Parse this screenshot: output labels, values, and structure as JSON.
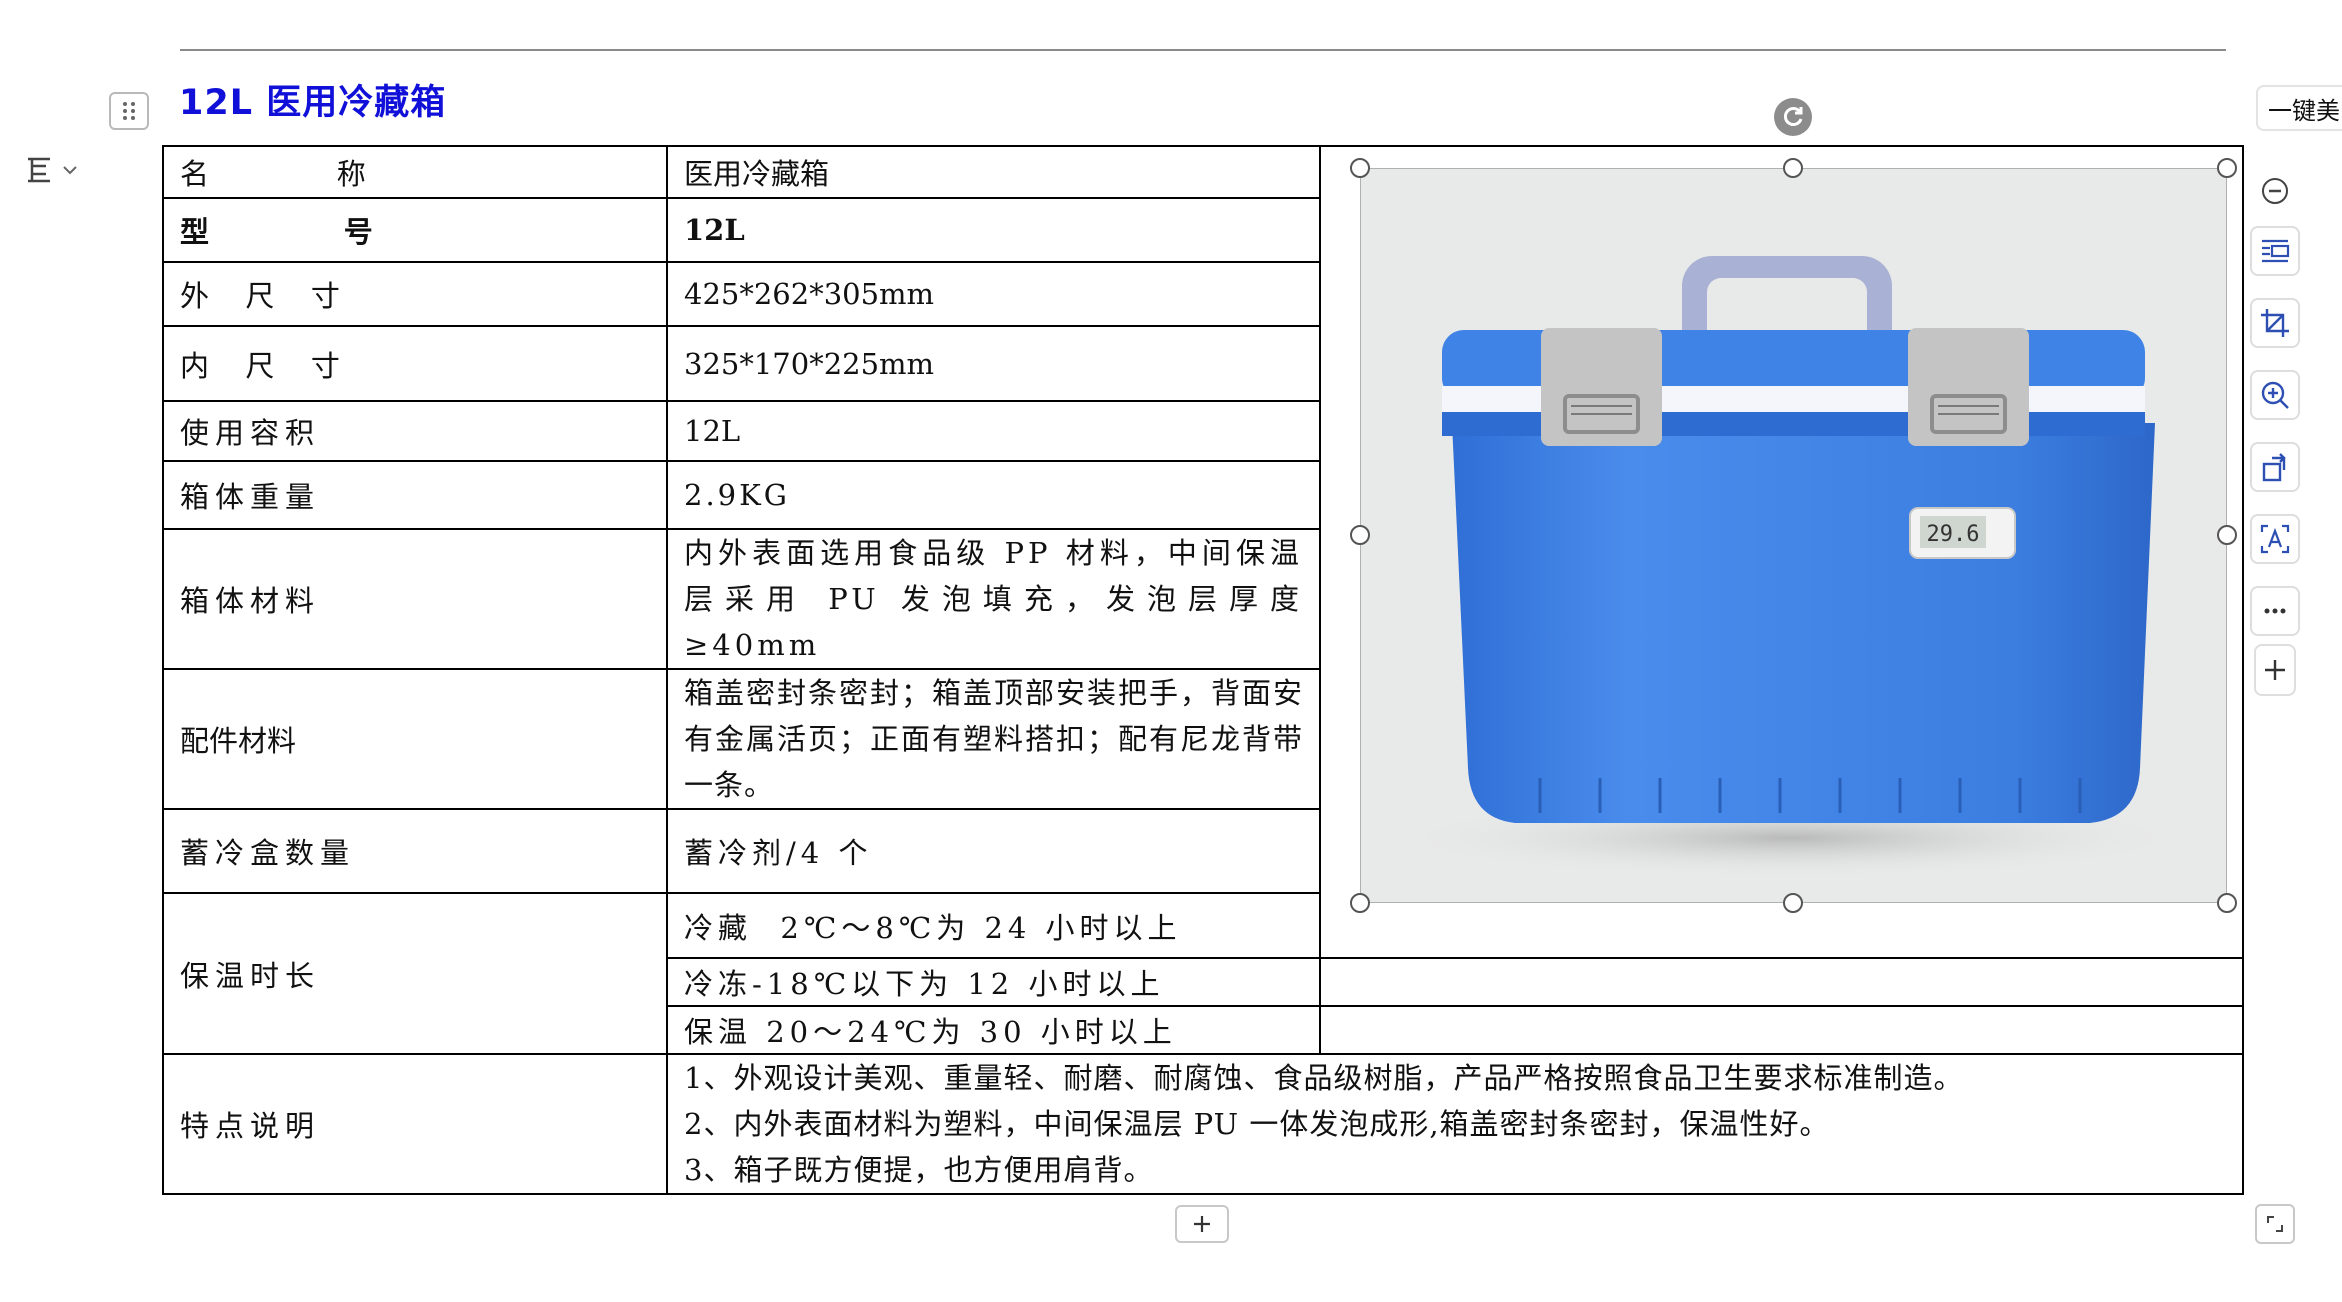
{
  "document": {
    "title": "12L  医用冷藏箱"
  },
  "toolbar": {
    "beautify_label": "一键美",
    "buttons": [
      "zoom-out-icon",
      "text-wrap-icon",
      "crop-icon",
      "zoom-in-icon",
      "replace-image-icon",
      "ocr-text-icon",
      "more-icon",
      "add-icon"
    ]
  },
  "spec_table": {
    "rows": [
      {
        "label": "名        称",
        "value": "医用冷藏箱"
      },
      {
        "label": "型        号",
        "value": "12L"
      },
      {
        "label": "外  尺  寸",
        "value": "425*262*305mm"
      },
      {
        "label": "内  尺  寸",
        "value": "325*170*225mm"
      },
      {
        "label": "使用容积",
        "value": "12L"
      },
      {
        "label": "箱体重量",
        "value": "2.9KG"
      },
      {
        "label": "箱体材料",
        "value": "内外表面选用食品级 PP 材料，中间保温层采用 PU 发泡填充，发泡层厚度≥40mm"
      },
      {
        "label": "配件材料",
        "value": "箱盖密封条密封；箱盖顶部安装把手，背面安有金属活页；正面有塑料搭扣；配有尼龙背带一条。"
      },
      {
        "label": "蓄冷盒数量",
        "value": "蓄冷剂/4 个"
      }
    ],
    "insulation": {
      "label": "保温时长",
      "lines": [
        "冷藏  2℃～8℃为 24 小时以上",
        "冷冻-18℃以下为 12 小时以上",
        "保温 20～24℃为 30 小时以上"
      ]
    },
    "features": {
      "label": "特点说明",
      "lines": [
        "1、外观设计美观、重量轻、耐磨、耐腐蚀、食品级树脂，产品严格按照食品卫生要求标准制造。",
        "2、内外表面材料为塑料，中间保温层 PU 一体发泡成形,箱盖密封条密封，保温性好。",
        "3、箱子既方便提，也方便用肩背。"
      ]
    }
  },
  "product_image": {
    "display_reading": "29.6",
    "body_color": "#3b7ee0",
    "handle_color": "#a9b2d4",
    "latch_color": "#c4c4c4",
    "background_color": "#e8e9e9"
  }
}
